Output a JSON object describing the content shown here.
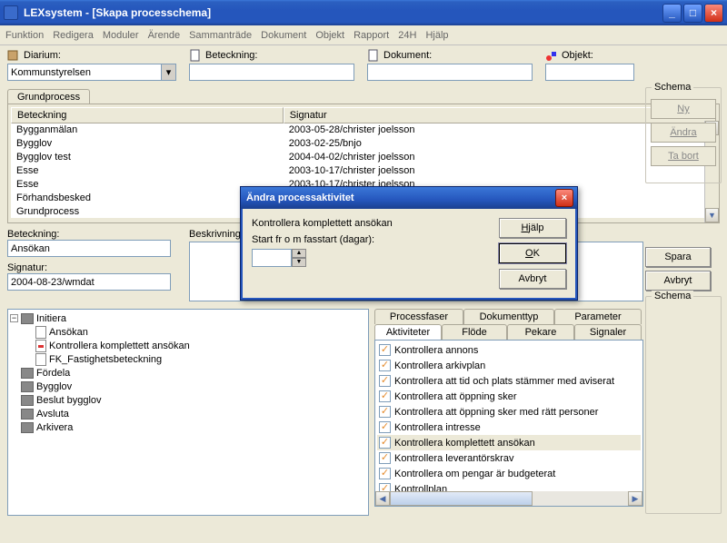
{
  "window_title": "LEXsystem - [Skapa processchema]",
  "menu": [
    "Funktion",
    "Redigera",
    "Moduler",
    "Ärende",
    "Sammanträde",
    "Dokument",
    "Objekt",
    "Rapport",
    "24H",
    "Hjälp"
  ],
  "toolbar": {
    "diarium": {
      "label": "Diarium:",
      "value": "Kommunstyrelsen"
    },
    "beteckning": {
      "label": "Beteckning:",
      "value": ""
    },
    "dokument": {
      "label": "Dokument:",
      "value": ""
    },
    "objekt": {
      "label": "Objekt:",
      "value": ""
    }
  },
  "tab_grundprocess": "Grundprocess",
  "grid": {
    "headers": {
      "beteckning": "Beteckning",
      "signatur": "Signatur"
    },
    "rows": [
      {
        "b": "Bygganmälan",
        "s": "2003-05-28/christer joelsson"
      },
      {
        "b": "Bygglov",
        "s": "2003-02-25/bnjo"
      },
      {
        "b": "Bygglov test",
        "s": "2004-04-02/christer joelsson"
      },
      {
        "b": "Esse",
        "s": "2003-10-17/christer joelsson"
      },
      {
        "b": "Esse",
        "s": "2003-10-17/christer joelsson"
      },
      {
        "b": "Förhandsbesked",
        "s": ""
      },
      {
        "b": "Grundprocess",
        "s": ""
      }
    ]
  },
  "mid": {
    "beteckning_lbl": "Beteckning:",
    "beteckning_val": "Ansökan",
    "signatur_lbl": "Signatur:",
    "signatur_val": "2004-08-23/wmdat",
    "beskrivning_lbl": "Beskrivning:"
  },
  "tree": {
    "root": "Initiera",
    "children": [
      {
        "label": "Ansökan",
        "kind": "leaf"
      },
      {
        "label": "Kontrollera komplettett ansökan",
        "kind": "leaf-red"
      },
      {
        "label": "FK_Fastighetsbeteckning",
        "kind": "leaf"
      }
    ],
    "siblings": [
      "Fördela",
      "Bygglov",
      "Beslut bygglov",
      "Avsluta",
      "Arkivera"
    ]
  },
  "right_tabs_top": [
    "Processfaser",
    "Dokumenttyp",
    "Parameter"
  ],
  "right_tabs_bottom": [
    "Aktiviteter",
    "Flöde",
    "Pekare",
    "Signaler"
  ],
  "checklist": [
    "Kontrollera annons",
    "Kontrollera arkivplan",
    "Kontrollera att tid och plats stämmer med aviserat",
    "Kontrollera att öppning sker",
    "Kontrollera att öppning sker med rätt personer",
    "Kontrollera intresse",
    "Kontrollera komplettett ansökan",
    "Kontrollera leverantörskrav",
    "Kontrollera om pengar är budgeterat",
    "Kontrollplan"
  ],
  "checklist_selected_index": 6,
  "side": {
    "schema_caption": "Schema",
    "ny": "Ny",
    "andra": "Ändra",
    "tabort": "Ta bort",
    "spara": "Spara",
    "avbryt": "Avbryt"
  },
  "dialog": {
    "title": "Ändra processaktivitet",
    "lbl1": "Kontrollera komplettett ansökan",
    "lbl2": "Start fr o m fasstart (dagar):",
    "hjalp": "Hjälp",
    "ok": "OK",
    "avbryt": "Avbryt",
    "spinner_value": ""
  }
}
